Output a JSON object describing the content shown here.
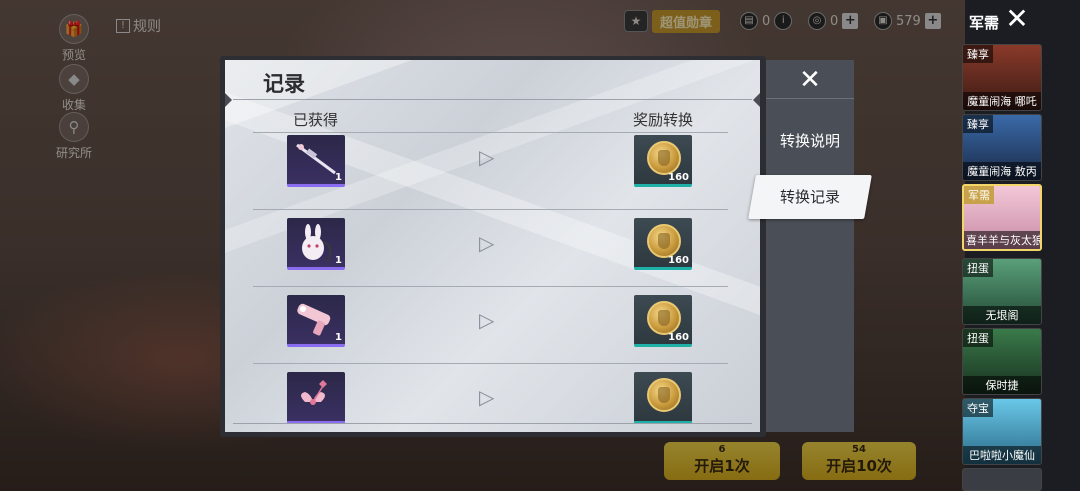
{
  "background": {
    "side_buttons": [
      {
        "label": "预览",
        "icon": "gift-icon"
      },
      {
        "label": "收集",
        "icon": "gem-icon"
      },
      {
        "label": "研究所",
        "icon": "magnifier-icon"
      }
    ],
    "rules_label": "规则",
    "promo_label": "超值勋章",
    "currencies": [
      {
        "icon": "ticket-icon",
        "value": "0"
      },
      {
        "icon": "coin-icon",
        "value": "0"
      },
      {
        "icon": "card-icon",
        "value": "579"
      }
    ],
    "open_buttons": [
      {
        "label": "开启1次",
        "cost": "6"
      },
      {
        "label": "开启10次",
        "cost": "54"
      }
    ]
  },
  "dialog": {
    "title": "记录",
    "col_obtained": "已获得",
    "col_reward": "奖励转换",
    "rows": [
      {
        "item_icon": "rifle-icon",
        "item_count": "1",
        "reward_count": "160"
      },
      {
        "item_icon": "bunny-backpack-icon",
        "item_count": "1",
        "reward_count": "160"
      },
      {
        "item_icon": "pink-pistol-icon",
        "item_count": "1",
        "reward_count": "160"
      },
      {
        "item_icon": "bow-ornament-icon",
        "item_count": "",
        "reward_count": ""
      }
    ]
  },
  "side_panel": {
    "tab_info": "转换说明",
    "tab_record": "转换记录"
  },
  "right_column": {
    "title": "军需",
    "banners": [
      {
        "tag": "臻享",
        "name": "魔童闹海 哪吒",
        "color": "#6b2a20"
      },
      {
        "tag": "臻享",
        "name": "魔童闹海 敖丙",
        "color": "#2c4a78"
      },
      {
        "tag": "军需",
        "name": "喜羊羊与灰太狼",
        "color": "#d49ab0"
      },
      {
        "tag": "扭蛋",
        "name": "无垠阁",
        "color": "#3c7a5c"
      },
      {
        "tag": "扭蛋",
        "name": "保时捷",
        "color": "#2e5a3a"
      },
      {
        "tag": "夺宝",
        "name": "巴啦啦小魔仙",
        "color": "#3aa0c8"
      }
    ]
  }
}
